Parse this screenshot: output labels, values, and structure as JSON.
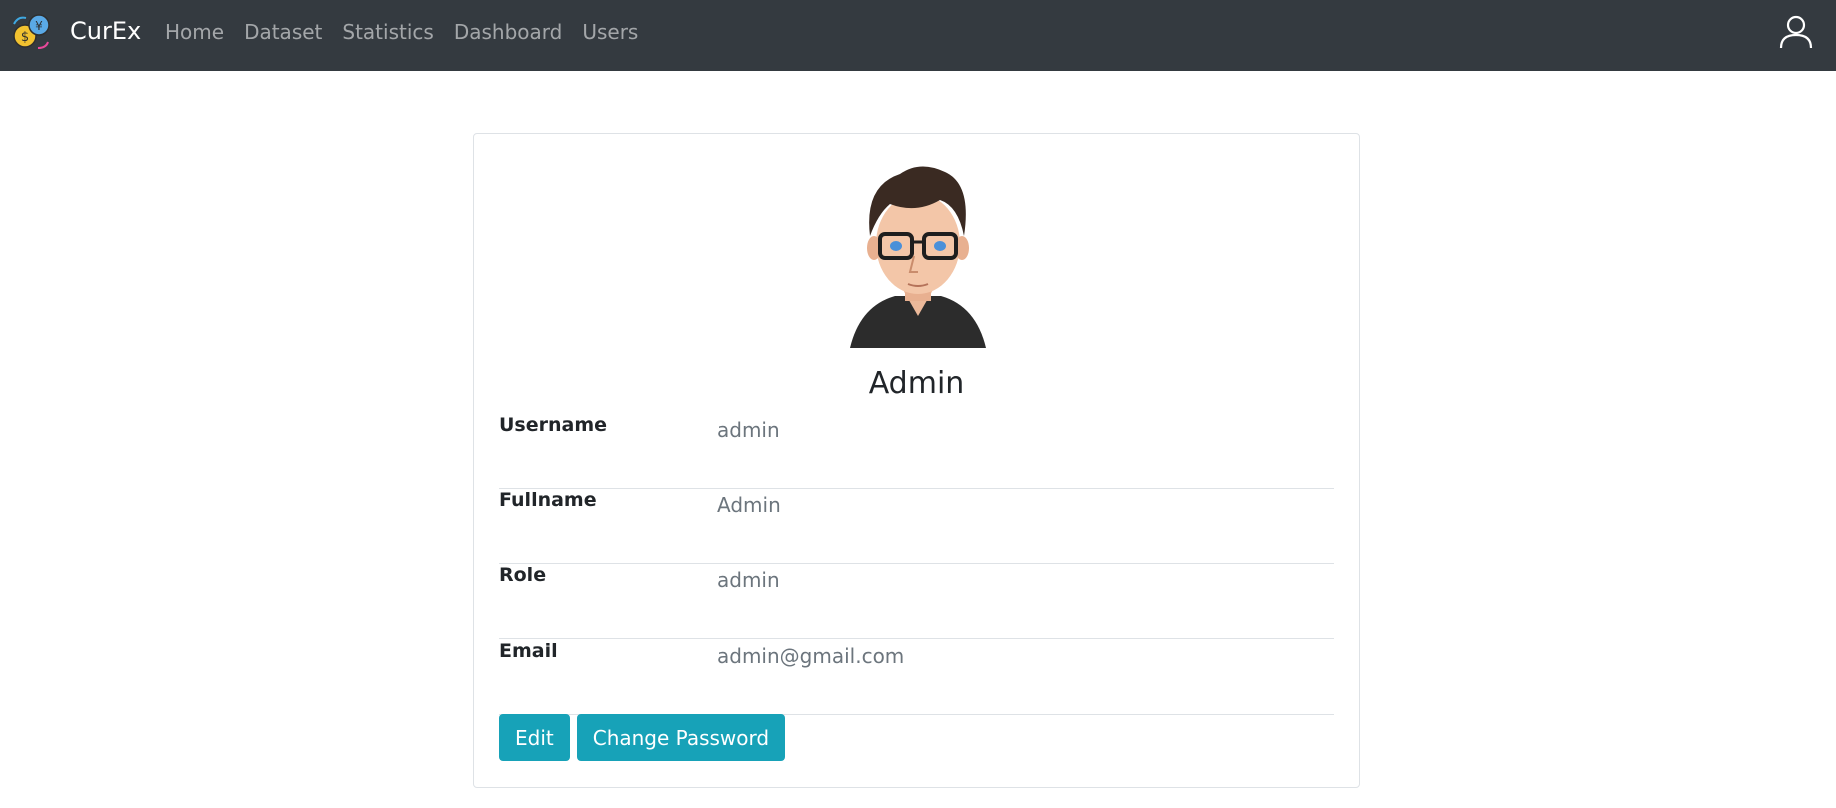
{
  "navbar": {
    "brand": "CurEx",
    "links": [
      "Home",
      "Dataset",
      "Statistics",
      "Dashboard",
      "Users"
    ]
  },
  "profile": {
    "name": "Admin",
    "fields": [
      {
        "label": "Username",
        "value": "admin"
      },
      {
        "label": "Fullname",
        "value": "Admin"
      },
      {
        "label": "Role",
        "value": "admin"
      },
      {
        "label": "Email",
        "value": "admin@gmail.com"
      }
    ]
  },
  "actions": {
    "edit_label": "Edit",
    "change_password_label": "Change Password"
  },
  "icons": {
    "brand_logo": "currency-exchange-icon",
    "user": "user-icon",
    "avatar": "avatar"
  },
  "colors": {
    "navbar_bg": "#343a40",
    "button_bg": "#17a2b8"
  }
}
